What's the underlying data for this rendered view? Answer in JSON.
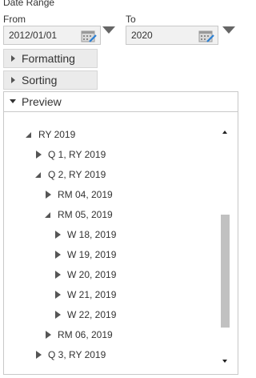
{
  "date_range": {
    "section_label": "Date Range",
    "from": {
      "label": "From",
      "value": "2012/01/01"
    },
    "to": {
      "label": "To",
      "value": "2020"
    }
  },
  "accordion": {
    "formatting": "Formatting",
    "sorting": "Sorting",
    "preview": "Preview"
  },
  "tree": [
    {
      "label": "RY 2019",
      "state": "expanded"
    },
    {
      "label": "Q 1, RY 2019",
      "state": "collapsed"
    },
    {
      "label": "Q 2, RY 2019",
      "state": "expanded"
    },
    {
      "label": "RM 04, 2019",
      "state": "collapsed"
    },
    {
      "label": "RM 05, 2019",
      "state": "expanded"
    },
    {
      "label": "W 18, 2019",
      "state": "collapsed"
    },
    {
      "label": "W 19, 2019",
      "state": "collapsed"
    },
    {
      "label": "W 20, 2019",
      "state": "collapsed"
    },
    {
      "label": "W 21, 2019",
      "state": "collapsed"
    },
    {
      "label": "W 22, 2019",
      "state": "collapsed"
    },
    {
      "label": "RM 06, 2019",
      "state": "collapsed"
    },
    {
      "label": "Q 3, RY 2019",
      "state": "collapsed"
    }
  ],
  "icons": {
    "calendar": "calendar-icon",
    "dropdown": "chevron-down-icon",
    "expand": "triangle-right-icon",
    "collapse": "triangle-down-icon"
  }
}
